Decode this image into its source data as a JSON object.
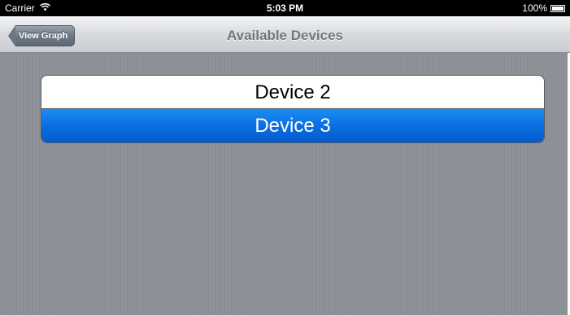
{
  "status_bar": {
    "carrier": "Carrier",
    "time": "5:03 PM",
    "battery": "100%",
    "wifi_icon": "wifi-icon",
    "battery_icon": "battery-icon"
  },
  "nav_bar": {
    "back_label": "View Graph",
    "title": "Available Devices"
  },
  "devices": [
    {
      "label": "Device 2",
      "selected": false
    },
    {
      "label": "Device 3",
      "selected": true
    }
  ],
  "colors": {
    "selection_blue": "#0a6fe1",
    "nav_title": "#6f767d",
    "background": "#8d9096"
  }
}
